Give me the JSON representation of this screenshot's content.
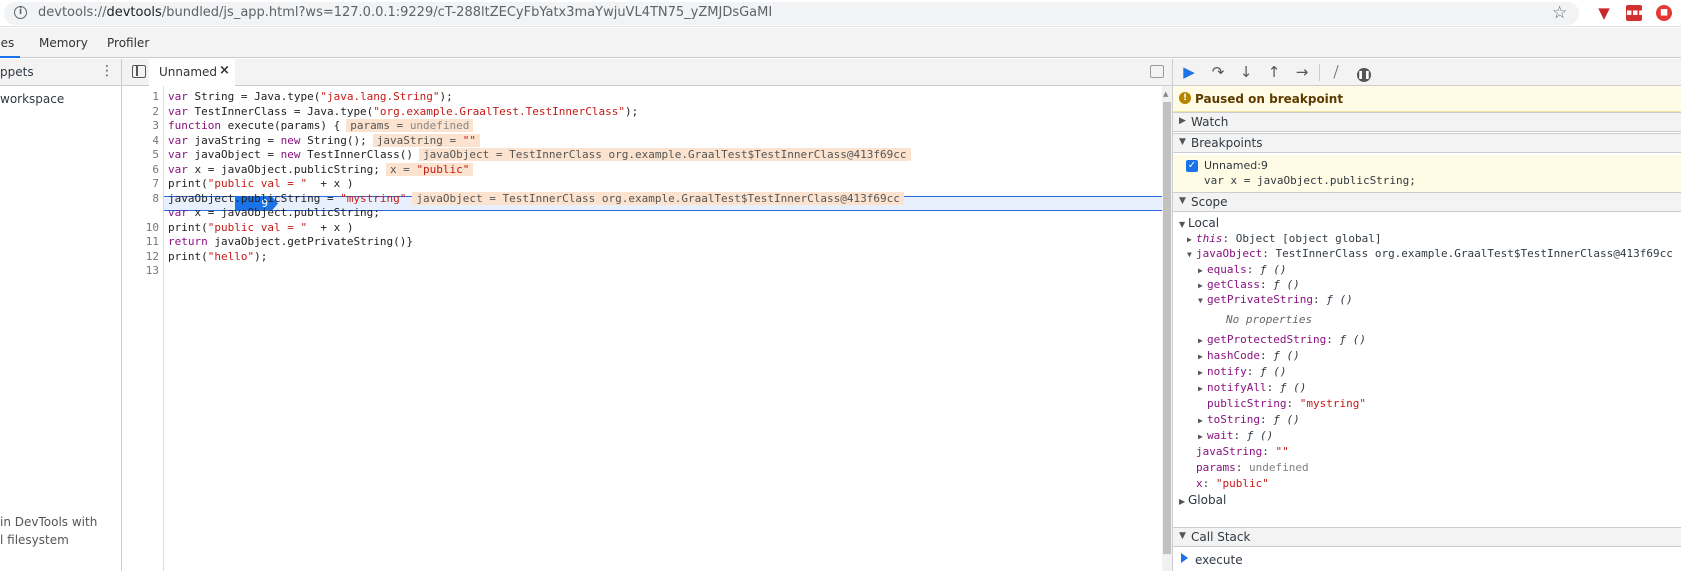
{
  "browser": {
    "url_scheme": "devtools://",
    "url_host": "devtools",
    "url_path": "/bundled/js_app.html?ws=127.0.0.1:9229/cT-288ltZECyFbYatx3maYwjuVL4TN75_yZMJDsGaMI"
  },
  "panel_tabs": {
    "sources": "ces",
    "memory": "Memory",
    "profiler": "Profiler"
  },
  "navigator": {
    "tab": "ppets",
    "workspace": "workspace",
    "hint_line1": "in DevTools with",
    "hint_line2": "l filesystem"
  },
  "editor": {
    "file_tab": "Unnamed",
    "line_numbers": [
      "1",
      "2",
      "3",
      "4",
      "5",
      "6",
      "7",
      "8",
      "9",
      "10",
      "11",
      "12",
      "13"
    ],
    "exec_line_number": "9"
  },
  "code": {
    "l1_kw": "var",
    "l1_a": " String = Java.type(",
    "l1_s": "\"java.lang.String\"",
    "l1_b": ");",
    "l2_kw": "var",
    "l2_a": " TestInnerClass = Java.type(",
    "l2_s": "\"org.example.GraalTest.TestInnerClass\"",
    "l2_b": ");",
    "l3_kw": "function",
    "l3_a": " execute(params) {",
    "l3_inl_k": "params = ",
    "l3_inl_v": "undefined",
    "l4_kw": "var",
    "l4_a": " javaString = ",
    "l4_kw2": "new",
    "l4_b": " String();",
    "l4_inl_k": "javaString = ",
    "l4_inl_v": "\"\"",
    "l5_kw": "var",
    "l5_a": " javaObject = ",
    "l5_kw2": "new",
    "l5_b": " TestInnerClass()",
    "l5_inl": "javaObject = TestInnerClass org.example.GraalTest$TestInnerClass@413f69cc",
    "l6_kw": "var",
    "l6_a": " x = javaObject.publicString;",
    "l6_inl_k": "x = ",
    "l6_inl_v": "\"public\"",
    "l7_a": "print(",
    "l7_s": "\"public val = \"",
    "l7_b": "  + x )",
    "l8_a": "javaObject.publicString = ",
    "l8_s": "\"mystring\"",
    "l8_inl": "javaObject = TestInnerClass org.example.GraalTest$TestInnerClass@413f69cc",
    "l9_kw": "var",
    "l9_a": " x = javaObject.publicString;",
    "l10_a": "print(",
    "l10_s": "\"public val = \"",
    "l10_b": "  + x )",
    "l11_kw": "return",
    "l11_a": " javaObject.getPrivateString()}",
    "l12_a": "print(",
    "l12_s": "\"hello\"",
    "l12_b": ");"
  },
  "debugger": {
    "paused": "Paused on breakpoint",
    "watch": "Watch",
    "breakpoints": "Breakpoints",
    "bp_location": "Unnamed:9",
    "bp_code": "var x = javaObject.publicString;",
    "scope": "Scope",
    "local": "Local",
    "this_key": "this",
    "this_val": ": Object [object global]",
    "jo_key": "javaObject",
    "jo_val": ": TestInnerClass org.example.GraalTest$TestInnerClass@413f69cc",
    "methods": {
      "equals": "equals",
      "getClass": "getClass",
      "getPrivateString": "getPrivateString",
      "getProtectedString": "getProtectedString",
      "hashCode": "hashCode",
      "notify": "notify",
      "notifyAll": "notifyAll",
      "toString": "toString",
      "wait": "wait"
    },
    "fn_sig": "ƒ ()",
    "no_properties": "No properties",
    "publicString_key": "publicString",
    "publicString_val": "\"mystring\"",
    "javaString_key": "javaString",
    "javaString_val": "\"\"",
    "params_key": "params",
    "params_val": "undefined",
    "x_key": "x",
    "x_val": "\"public\"",
    "global": "Global",
    "call_stack": "Call Stack",
    "call_frame": "execute"
  }
}
